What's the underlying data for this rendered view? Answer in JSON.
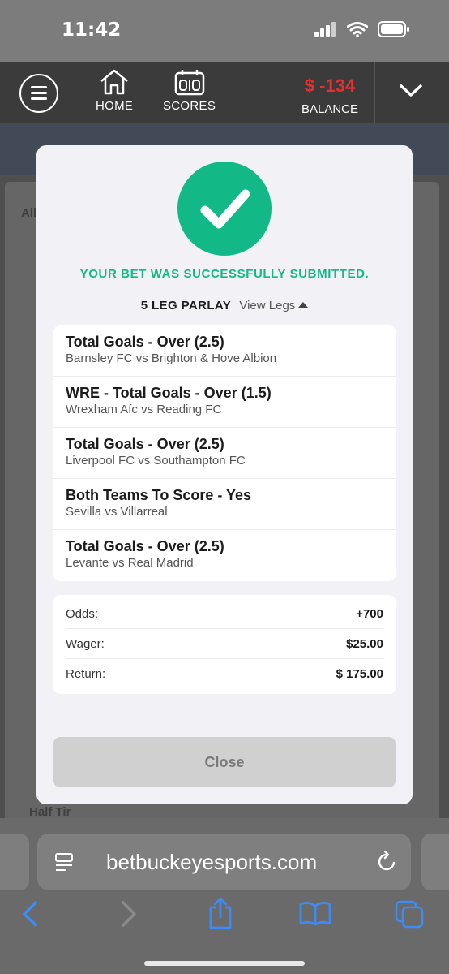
{
  "status": {
    "time": "11:42"
  },
  "nav": {
    "home_label": "HOME",
    "scores_label": "SCORES",
    "balance_value": "$ -134",
    "balance_label": "BALANCE"
  },
  "background": {
    "ghost_label_1": "All",
    "ghost_label_2": "Half Tir"
  },
  "modal": {
    "success_text": "YOUR BET WAS SUCCESSFULLY SUBMITTED.",
    "parlay_title": "5 LEG PARLAY",
    "view_legs_label": "View Legs",
    "legs": [
      {
        "title": "Total Goals - Over (2.5)",
        "match": "Barnsley FC vs Brighton & Hove Albion"
      },
      {
        "title": "WRE - Total Goals - Over (1.5)",
        "match": "Wrexham Afc vs Reading FC"
      },
      {
        "title": "Total Goals - Over (2.5)",
        "match": "Liverpool FC vs Southampton FC"
      },
      {
        "title": "Both Teams To Score - Yes",
        "match": "Sevilla vs Villarreal"
      },
      {
        "title": "Total Goals - Over (2.5)",
        "match": "Levante vs Real Madrid"
      }
    ],
    "summary": {
      "odds_label": "Odds:",
      "odds_value": "+700",
      "wager_label": "Wager:",
      "wager_value": "$25.00",
      "return_label": "Return:",
      "return_value": "$ 175.00"
    },
    "close_label": "Close"
  },
  "browser": {
    "url": "betbuckeyesports.com"
  },
  "colors": {
    "success": "#12b886",
    "balance_negative": "#e53030"
  }
}
